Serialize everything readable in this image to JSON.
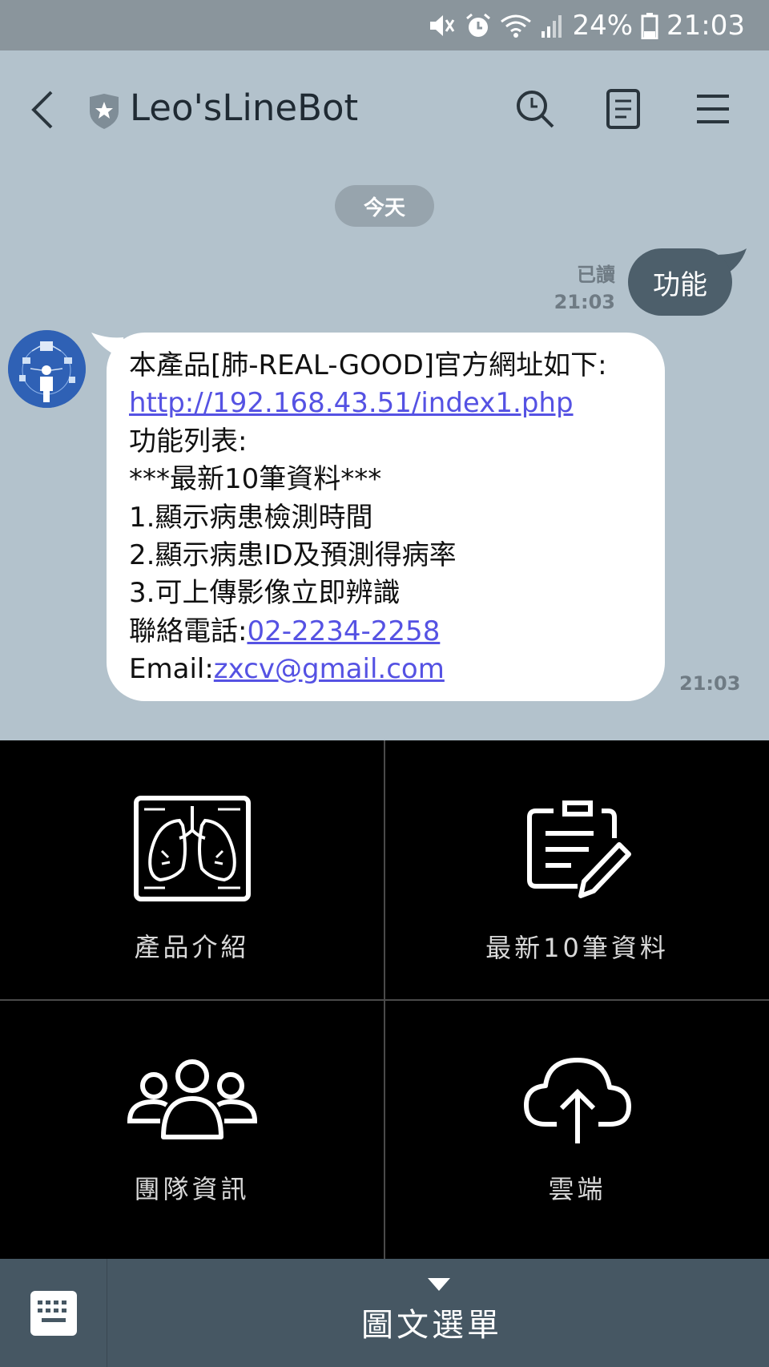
{
  "status_bar": {
    "battery": "24%",
    "time": "21:03",
    "icons": [
      "mute-icon",
      "alarm-icon",
      "wifi-icon",
      "signal-icon",
      "battery-icon"
    ]
  },
  "header": {
    "title": "Leo'sLineBot",
    "icons": [
      "back-icon",
      "shield-icon",
      "search-icon",
      "note-icon",
      "menu-icon"
    ]
  },
  "chat": {
    "date_label": "今天",
    "sent": {
      "read_label": "已讀",
      "time": "21:03",
      "text": "功能"
    },
    "received": {
      "time": "21:03",
      "lines": {
        "l1": "本產品[肺-REAL-GOOD]官方網址如下:",
        "url": "http://192.168.43.51/index1.php",
        "l3": "功能列表:",
        "l4": "***最新10筆資料***",
        "l5": "1.顯示病患檢測時間",
        "l6": "2.顯示病患ID及預測得病率",
        "l7": "3.可上傳影像立即辨識",
        "phone_prefix": "聯絡電話:",
        "phone": "02-2234-2258",
        "email_prefix": "Email:",
        "email": "zxcv@gmail.com"
      }
    }
  },
  "rich_menu": {
    "items": [
      {
        "label": "產品介紹",
        "icon": "lungs-xray-icon"
      },
      {
        "label": "最新10筆資料",
        "icon": "clipboard-edit-icon"
      },
      {
        "label": "團隊資訊",
        "icon": "team-icon"
      },
      {
        "label": "雲端",
        "icon": "cloud-upload-icon"
      }
    ]
  },
  "bottom_bar": {
    "menu_label": "圖文選單",
    "icons": [
      "keyboard-icon",
      "triangle-down-icon"
    ]
  },
  "colors": {
    "chat_bg": "#b3c2cc",
    "sent_bubble": "#4d5f6b",
    "link": "#5552e3",
    "rich_menu_bg": "#000000",
    "bottom_bar": "#465763"
  }
}
